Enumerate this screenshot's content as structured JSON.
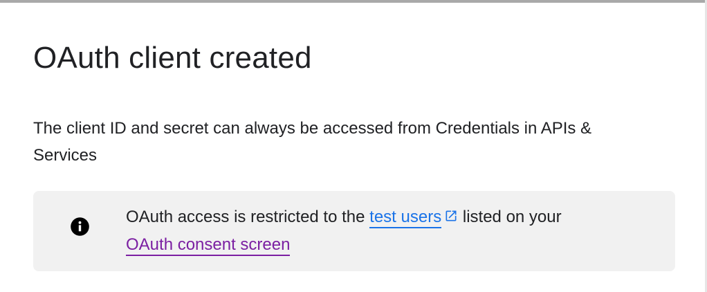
{
  "dialog": {
    "title": "OAuth client created",
    "description": "The client ID and secret can always be accessed from Credentials in APIs & Services"
  },
  "notice": {
    "icon": "info-icon",
    "text_before": "OAuth access is restricted to the ",
    "link_test_users": "test users",
    "text_after": " listed on your",
    "link_consent": "OAuth consent screen",
    "colors": {
      "link": "#1a73e8",
      "visited_link": "#7b1fa2",
      "background": "#f1f1f1"
    }
  }
}
